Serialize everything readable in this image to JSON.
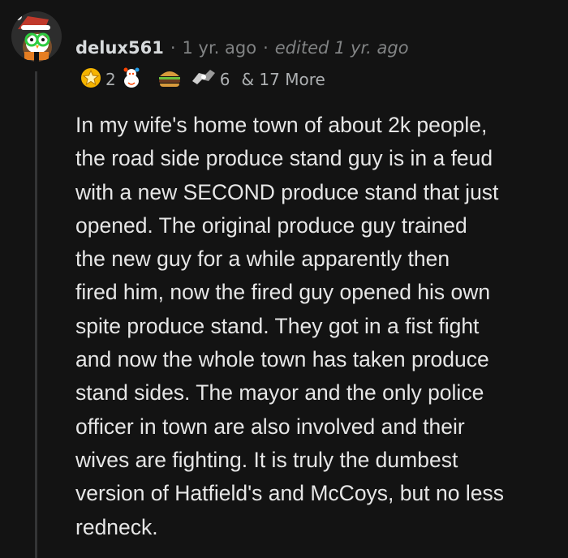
{
  "comment": {
    "username": "delux561",
    "separator": "·",
    "time": "1 yr. ago",
    "edited": "edited 1 yr. ago",
    "awards": {
      "first_count": "2",
      "second_count": "6",
      "more_label": "& 17 More"
    },
    "body_lines": [
      "In my wife's home town of about 2k people,",
      "the road side produce stand guy is in a feud",
      "with a new SECOND produce stand that just",
      "opened. The original produce guy trained",
      "the new guy for a while apparently then",
      "fired him, now the fired guy opened his own",
      "spite produce stand. They got in a fist fight",
      "and now the whole town has taken produce",
      "stand sides. The mayor and the only police",
      "officer in town are also involved and their",
      "wives are fighting. It is truly the dumbest",
      "version of Hatfield's and McCoys, but no less",
      "redneck."
    ]
  },
  "icons": {
    "avatar": "owl-avatar",
    "award_1": "star-award-icon",
    "award_2": "wholesome-award-icon",
    "award_3": "burger-award-icon",
    "award_4": "fist-bump-award-icon"
  }
}
